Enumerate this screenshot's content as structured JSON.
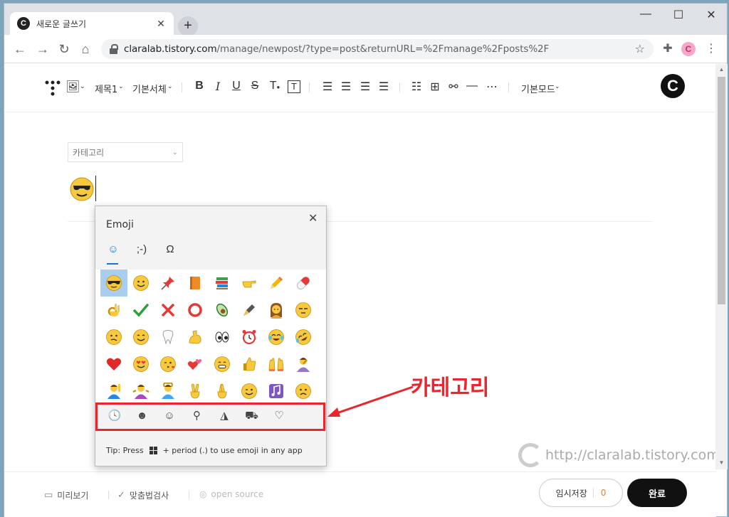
{
  "browser": {
    "tab_title": "새로운 글쓰기",
    "tab_favicon": "C",
    "new_tab": "+",
    "url_host": "claralab.tistory.com",
    "url_path": "/manage/newpost/?type=post&returnURL=%2Fmanage%2Fposts%2F",
    "profile_initial": "C",
    "window_controls": [
      "—",
      "☐",
      "✕"
    ]
  },
  "editor_toolbar": {
    "heading_label": "제목1",
    "font_label": "기본서체",
    "mode_label": "기본모드",
    "brand_initial": "C"
  },
  "post": {
    "category_placeholder": "카테고리",
    "title_emoji": "smiling-face-with-sunglasses"
  },
  "emoji_panel": {
    "title": "Emoji",
    "tabs": [
      {
        "icon": "smiley-tab-icon",
        "glyph": "☺",
        "active": true
      },
      {
        "icon": "kaomoji-tab-icon",
        "glyph": ";-)",
        "active": false
      },
      {
        "icon": "symbols-tab-icon",
        "glyph": "Ω",
        "active": false
      }
    ],
    "close": "✕",
    "categories": [
      {
        "icon": "recent-clock-icon",
        "glyph": "🕓",
        "active": true
      },
      {
        "icon": "smiley-category-icon",
        "glyph": "☻",
        "active": false
      },
      {
        "icon": "people-category-icon",
        "glyph": "☺",
        "active": false
      },
      {
        "icon": "celebration-category-icon",
        "glyph": "⚲",
        "active": false
      },
      {
        "icon": "food-category-icon",
        "glyph": "◮",
        "active": false
      },
      {
        "icon": "transport-category-icon",
        "glyph": "⛟",
        "active": false
      },
      {
        "icon": "heart-category-icon",
        "glyph": "♡",
        "active": false
      }
    ],
    "emojis": [
      "sunglasses-face",
      "grinning-face",
      "pushpin",
      "orange-book",
      "books",
      "backhand-index-pointing",
      "pencil",
      "pill",
      "ok-hand",
      "check-mark",
      "cross-mark",
      "hollow-red-circle",
      "avocado",
      "fountain-pen",
      "woman",
      "unamused-face",
      "confused-face",
      "smiling-face",
      "tooth",
      "flexed-biceps",
      "eyes",
      "alarm-clock",
      "tears-of-joy",
      "rolling-on-floor-laughing",
      "red-heart",
      "heart-eyes",
      "face-blowing-kiss",
      "two-hearts",
      "beaming-face",
      "thumbs-up",
      "raising-hands",
      "person-facepalming",
      "person-raising-hand",
      "person-shrugging",
      "person-gesturing-ok",
      "victory-hand",
      "crossed-fingers",
      "winking-face",
      "musical-notes",
      "sad-face"
    ],
    "tip_prefix": "Tip: Press",
    "tip_suffix": "+ period (.) to use emoji in any app"
  },
  "bottom_bar": {
    "preview": "미리보기",
    "spellcheck": "맞춤법검사",
    "open_source": "open source",
    "save_draft": "임시저장",
    "draft_count": "0",
    "publish": "완료"
  },
  "watermark": "http://claralab.tistory.com",
  "annotation": {
    "label": "카테고리",
    "color": "#e8262b"
  }
}
